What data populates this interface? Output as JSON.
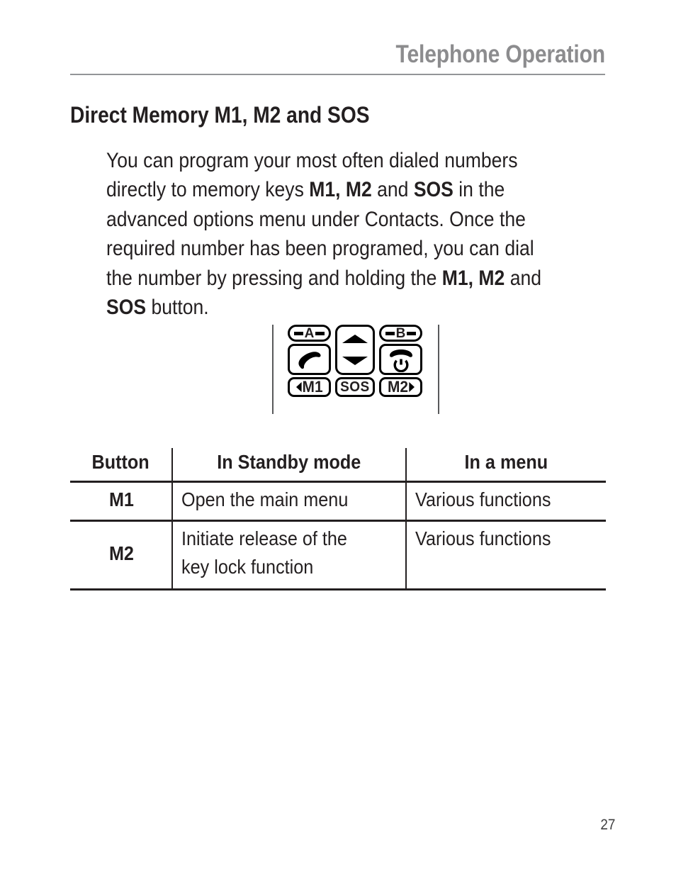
{
  "header": {
    "running_title": "Telephone Operation"
  },
  "section": {
    "heading": "Direct Memory M1, M2 and SOS",
    "paragraph": {
      "part1": "You can program your most often dialed numbers directly to memory keys ",
      "bold1": "M1, M2",
      "part2": " and ",
      "bold2": "SOS",
      "part3": " in the advanced options menu under Contacts. Once the required number has been programed, you can dial the number by pressing and holding the ",
      "bold3": "M1, M2",
      "part4": " and ",
      "bold4": "SOS",
      "part5": " button."
    }
  },
  "keypad": {
    "key_a_label": "A",
    "key_b_label": "B",
    "key_m1_label": "M1",
    "key_sos_label": "SOS",
    "key_m2_label": "M2",
    "icons": {
      "call": "phone-handset-icon",
      "end_call": "phone-hangup-icon",
      "power": "power-icon",
      "nav_up": "triangle-up-icon",
      "nav_down": "triangle-down-icon",
      "m1_arrow": "triangle-left-icon",
      "m2_arrow": "triangle-right-icon"
    }
  },
  "table": {
    "headers": [
      "Button",
      "In Standby mode",
      "In a menu"
    ],
    "rows": [
      {
        "button": "M1",
        "standby": "Open the main menu",
        "menu": "Various functions"
      },
      {
        "button": "M2",
        "standby": "Initiate release of the key lock function",
        "menu": "Various functions"
      }
    ]
  },
  "footer": {
    "page_number": "27"
  },
  "colors": {
    "header_gray": "#8c8c8e",
    "rule_gray": "#939598",
    "text_black": "#231f20",
    "folio_gray": "#404041"
  }
}
